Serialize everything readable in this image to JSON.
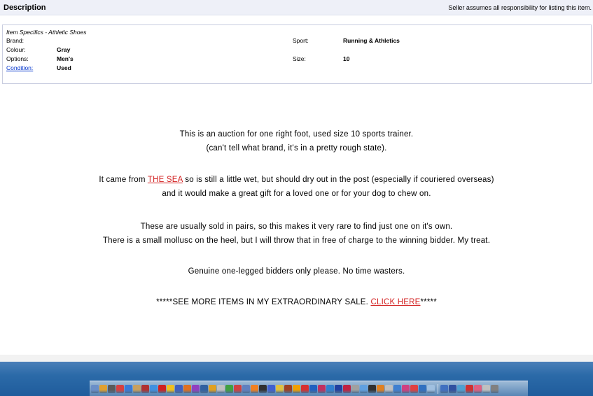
{
  "header": {
    "title": "Description",
    "note": "Seller assumes all responsibility for listing this item."
  },
  "specifics": {
    "heading": "Item Specifics - Athletic Shoes",
    "rows": [
      {
        "label": "Brand:",
        "value": ""
      },
      {
        "label": "Colour:",
        "value": "Gray"
      },
      {
        "label": "Options:",
        "value": "Men's"
      },
      {
        "label": "Condition:",
        "value": "Used"
      }
    ],
    "right_rows": [
      {
        "label": "Sport:",
        "value": "Running & Athletics"
      },
      {
        "label": "Size:",
        "value": "10"
      }
    ]
  },
  "description": {
    "p1_line1": "This is an auction for one right foot, used size 10 sports trainer.",
    "p1_line2": "(can't tell what brand, it's in a pretty rough state).",
    "p2_before": "It came from ",
    "p2_link": "THE SEA",
    "p2_after": " so is still a little wet, but should dry out in the post (especially if couriered overseas)",
    "p2_line2": "and it would make a great gift for a loved one or for your dog to chew on.",
    "p3_line1": "These are usually sold in pairs, so this makes it very rare to find just one on it's own.",
    "p3_line2": "There is a small mollusc on the heel, but I will throw that in free of charge to the winning bidder. My treat.",
    "p4": "Genuine one-legged bidders only please. No time wasters.",
    "p5_before": "*****SEE MORE ITEMS IN MY EXTRAORDINARY SALE. ",
    "p5_link": "CLICK HERE",
    "p5_after": "*****"
  },
  "dock": {
    "icon_colors": [
      "#6a8fc8",
      "#e0a030",
      "#5a5a5a",
      "#d84040",
      "#3a7ad8",
      "#c8a060",
      "#b03030",
      "#4090e0",
      "#d02020",
      "#f0c020",
      "#4060c0",
      "#e07020",
      "#9040c0",
      "#3060a0",
      "#e0a020",
      "#c0c0c0",
      "#40a040",
      "#d04040",
      "#6080c0",
      "#f08020",
      "#303030",
      "#4060d0",
      "#e0c040",
      "#a04020",
      "#f0a000",
      "#d83030",
      "#2060c0",
      "#c03060",
      "#3080d0",
      "#2040a0",
      "#c02040",
      "#a0a0a0",
      "#60a0e0",
      "#303030",
      "#e08020",
      "#c0c0c0",
      "#4080d0",
      "#d04080",
      "#e04040",
      "#3070c0",
      "#a0c0e0",
      "#4070c0",
      "#3050a0",
      "#50a0d0",
      "#d03030",
      "#e06080",
      "#c0c0c0",
      "#808080"
    ]
  }
}
